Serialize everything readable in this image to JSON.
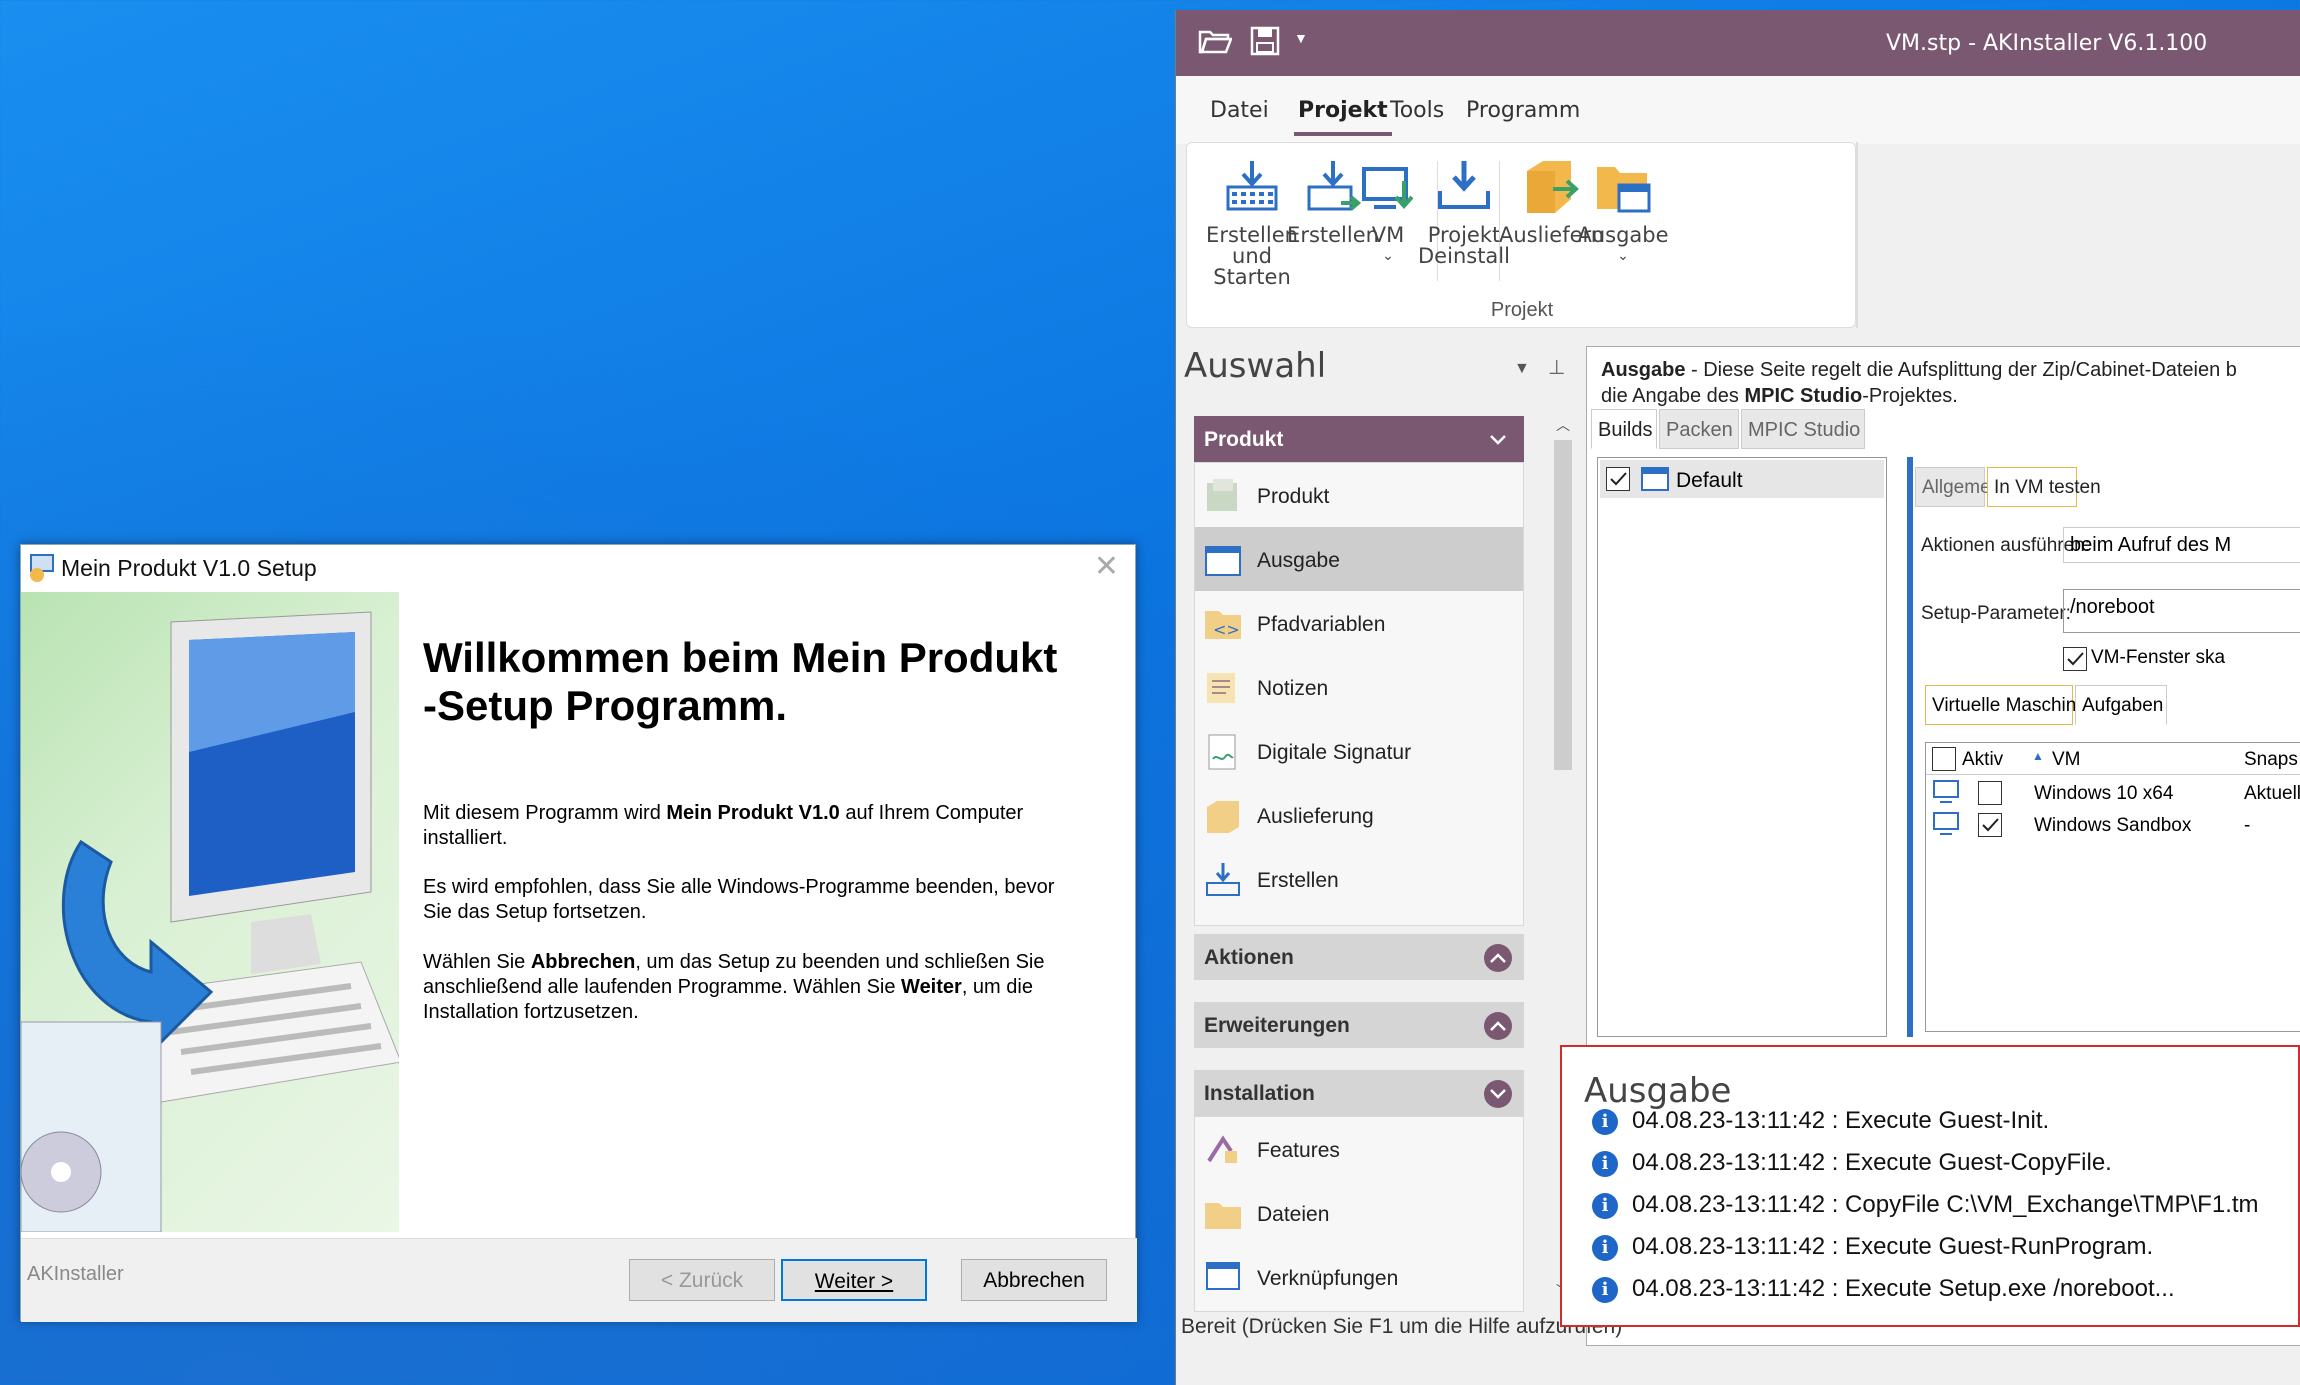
{
  "app": {
    "title": "VM.stp - AKInstaller V6.1.100",
    "menu": [
      "Datei",
      "Projekt",
      "Tools",
      "Programm"
    ],
    "ribbon": {
      "btn1": [
        "Erstellen",
        "und Starten"
      ],
      "btn2": "Erstellen",
      "btn3": "VM",
      "btn4": [
        "Projekt",
        "Deinstall"
      ],
      "btn5": "Ausliefern",
      "btn6": "Ausgabe",
      "group": "Projekt"
    },
    "left": {
      "title": "Auswahl",
      "produkt": "Produkt",
      "items": [
        "Produkt",
        "Ausgabe",
        "Pfadvariablen",
        "Notizen",
        "Digitale Signatur",
        "Auslieferung",
        "Erstellen"
      ],
      "aktionen": "Aktionen",
      "erweiterungen": "Erweiterungen",
      "installation": "Installation",
      "inst_items": [
        "Features",
        "Dateien",
        "Verknüpfungen"
      ]
    },
    "info": {
      "bold1": "Ausgabe",
      "text1": " - Diese Seite regelt die Aufsplittung der Zip/Cabinet-Dateien b",
      "text2a": "die Angabe des ",
      "bold2": "MPIC Studio",
      "text2b": "-Projektes."
    },
    "tabs": [
      "Builds",
      "Packen",
      "MPIC Studio"
    ],
    "build": "Default",
    "subtabs": [
      "Allgemein",
      "In VM testen"
    ],
    "aktionen_label": "Aktionen ausführen:",
    "aktionen_value": "beim Aufruf des M",
    "setup_label": "Setup-Parameter:",
    "setup_value": "/noreboot",
    "vmwindow": "VM-Fenster ska",
    "vmtabs": [
      "Virtuelle Maschinen",
      "Aufgaben"
    ],
    "cols": [
      "Aktiv",
      "VM",
      "Snaps"
    ],
    "vms": [
      {
        "name": "Windows 10 x64",
        "snap": "Aktuell",
        "checked": false
      },
      {
        "name": "Windows Sandbox",
        "snap": "-",
        "checked": true
      }
    ],
    "status": "Bereit (Drücken Sie F1 um die Hilfe aufzurufen)"
  },
  "output": {
    "title": "Ausgabe",
    "lines": [
      "04.08.23-13:11:42 : Execute Guest-Init.",
      "04.08.23-13:11:42 : Execute Guest-CopyFile.",
      "04.08.23-13:11:42 : CopyFile C:\\VM_Exchange\\TMP\\F1.tm",
      "04.08.23-13:11:42 : Execute Guest-RunProgram.",
      "04.08.23-13:11:42 : Execute Setup.exe /noreboot..."
    ]
  },
  "dialog": {
    "title": "Mein Produkt V1.0 Setup",
    "heading1": "Willkommen beim Mein Produkt",
    "heading2": "-Setup Programm.",
    "p1a": "Mit diesem Programm wird ",
    "p1b": "Mein Produkt V1.0",
    "p1c": " auf Ihrem Computer",
    "p1d": "installiert.",
    "p2a": "Es wird empfohlen, dass Sie alle Windows-Programme beenden, bevor",
    "p2b": "Sie das Setup fortsetzen.",
    "p3a": "Wählen Sie ",
    "p3b": "Abbrechen",
    "p3c": ", um das Setup zu beenden und schließen Sie",
    "p3d": "anschließend alle laufenden Programme. Wählen Sie ",
    "p3e": "Weiter",
    "p3f": ", um die",
    "p3g": "Installation fortzusetzen.",
    "brand": "AKInstaller",
    "back": "< Zurück",
    "next": "Weiter >",
    "cancel": "Abbrechen"
  },
  "colors": {
    "accent": "#7b5871",
    "desktop": "#0b74e0",
    "link": "#2e6fc6"
  }
}
